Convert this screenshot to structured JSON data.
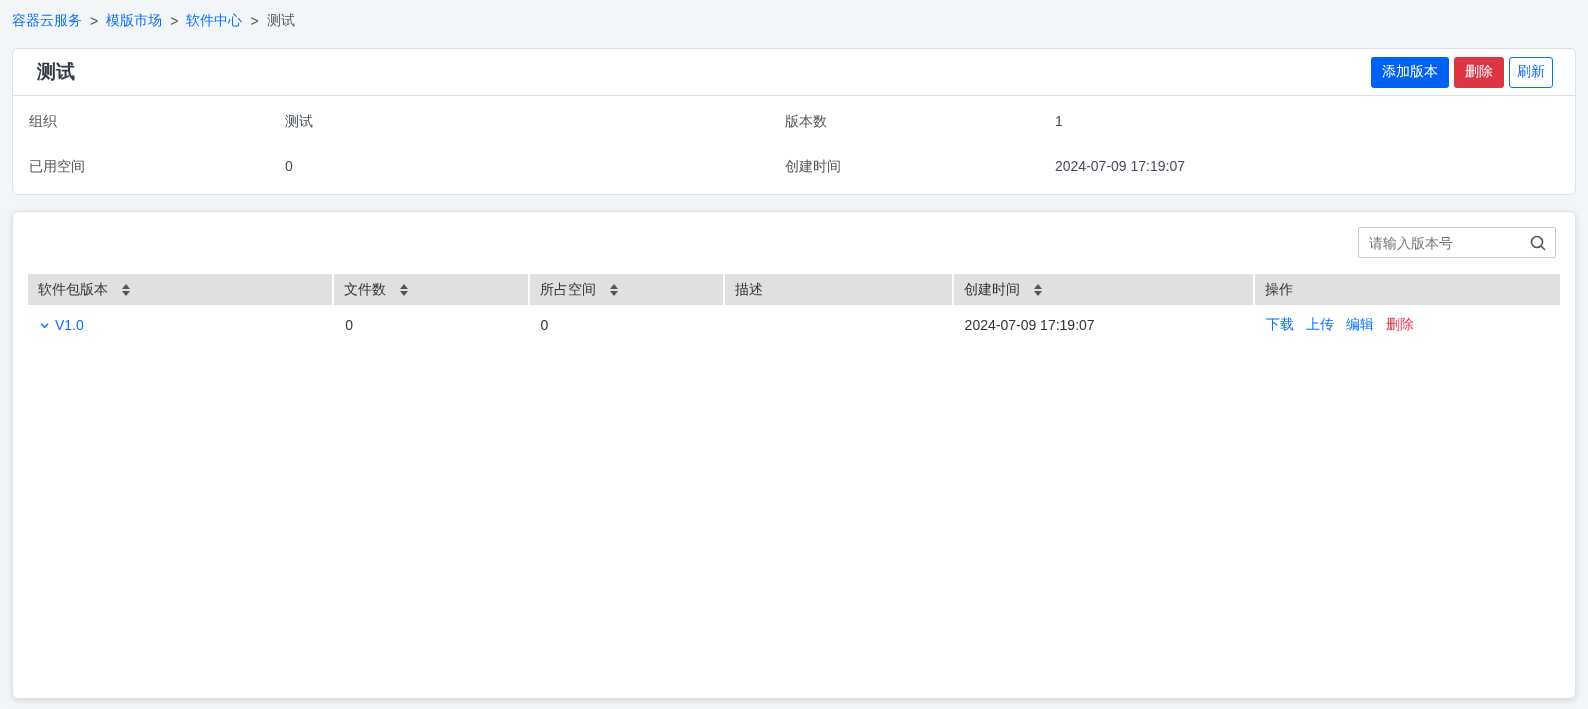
{
  "breadcrumb": [
    {
      "label": "容器云服务",
      "link": true
    },
    {
      "label": "模版市场",
      "link": true
    },
    {
      "label": "软件中心",
      "link": true
    },
    {
      "label": "测试",
      "link": false
    }
  ],
  "breadcrumb_separator": ">",
  "detail": {
    "title": "测试",
    "buttons": [
      {
        "label": "添加版本",
        "kind": "primary"
      },
      {
        "label": "删除",
        "kind": "danger"
      },
      {
        "label": "刷新",
        "kind": "outline"
      }
    ],
    "fields": [
      {
        "label": "组织",
        "value": "测试"
      },
      {
        "label": "版本数",
        "value": "1"
      },
      {
        "label": "已用空间",
        "value": "0"
      },
      {
        "label": "创建时间",
        "value": "2024-07-09 17:19:07"
      }
    ]
  },
  "versions": {
    "search": {
      "placeholder": "请输入版本号"
    },
    "columns": [
      {
        "label": "软件包版本",
        "sortable": true
      },
      {
        "label": "文件数",
        "sortable": true
      },
      {
        "label": "所占空间",
        "sortable": true
      },
      {
        "label": "描述",
        "sortable": false
      },
      {
        "label": "创建时间",
        "sortable": true
      },
      {
        "label": "操作",
        "sortable": false
      }
    ],
    "rows": [
      {
        "version": "V1.0",
        "expanded": true,
        "files": "0",
        "space": "0",
        "description": "",
        "created": "2024-07-09 17:19:07",
        "actions": [
          {
            "label": "下载",
            "kind": "link"
          },
          {
            "label": "上传",
            "kind": "link"
          },
          {
            "label": "编辑",
            "kind": "link"
          },
          {
            "label": "删除",
            "kind": "danger"
          }
        ]
      }
    ]
  }
}
